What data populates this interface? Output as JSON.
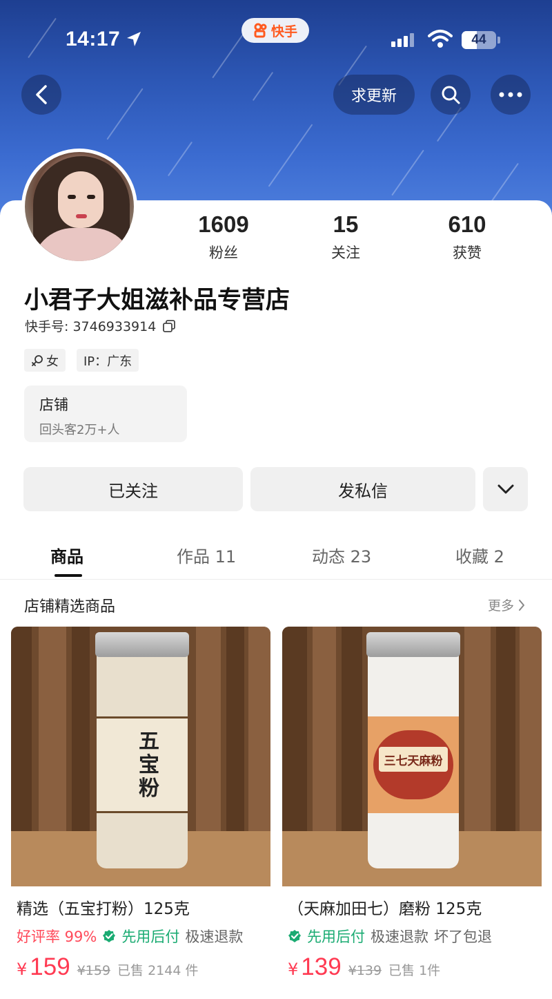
{
  "status_bar": {
    "time": "14:17",
    "app_badge": "快手",
    "battery": "44"
  },
  "header_actions": {
    "request_update": "求更新"
  },
  "profile": {
    "stats": [
      {
        "value": "1609",
        "label": "粉丝"
      },
      {
        "value": "15",
        "label": "关注"
      },
      {
        "value": "610",
        "label": "获赞"
      }
    ],
    "shop_name": "小君子大姐滋补品专营店",
    "kuaishou_id": "快手号: 3746933914",
    "tags": [
      {
        "label": "女",
        "icon": "female-icon"
      },
      {
        "label": "IP：广东"
      }
    ],
    "store": {
      "title": "店铺",
      "subtitle": "回头客2万+人"
    }
  },
  "actions": {
    "followed": "已关注",
    "message": "发私信"
  },
  "tabs": [
    {
      "label": "商品",
      "active": true
    },
    {
      "label": "作品 11",
      "active": false
    },
    {
      "label": "动态 23",
      "active": false
    },
    {
      "label": "收藏 2",
      "active": false
    }
  ],
  "section": {
    "title": "店铺精选商品",
    "more": "更多"
  },
  "products": [
    {
      "title": "精选（五宝打粉）125克",
      "rating": "好评率 99%",
      "badges": [
        "先用后付",
        "极速退款"
      ],
      "price_symbol": "¥",
      "price": "159",
      "original_price": "¥159",
      "sold": "已售 2144 件",
      "label_text": "五宝粉"
    },
    {
      "title": "（天麻加田七）磨粉 125克",
      "rating": "",
      "badges": [
        "先用后付",
        "极速退款",
        "坏了包退"
      ],
      "price_symbol": "¥",
      "price": "139",
      "original_price": "¥139",
      "sold": "已售 1件",
      "label_text": "三七天麻粉"
    }
  ],
  "colors": {
    "price": "#ff3a52",
    "badge_green": "#1aab72",
    "rating_red": "#ff4a5a"
  }
}
